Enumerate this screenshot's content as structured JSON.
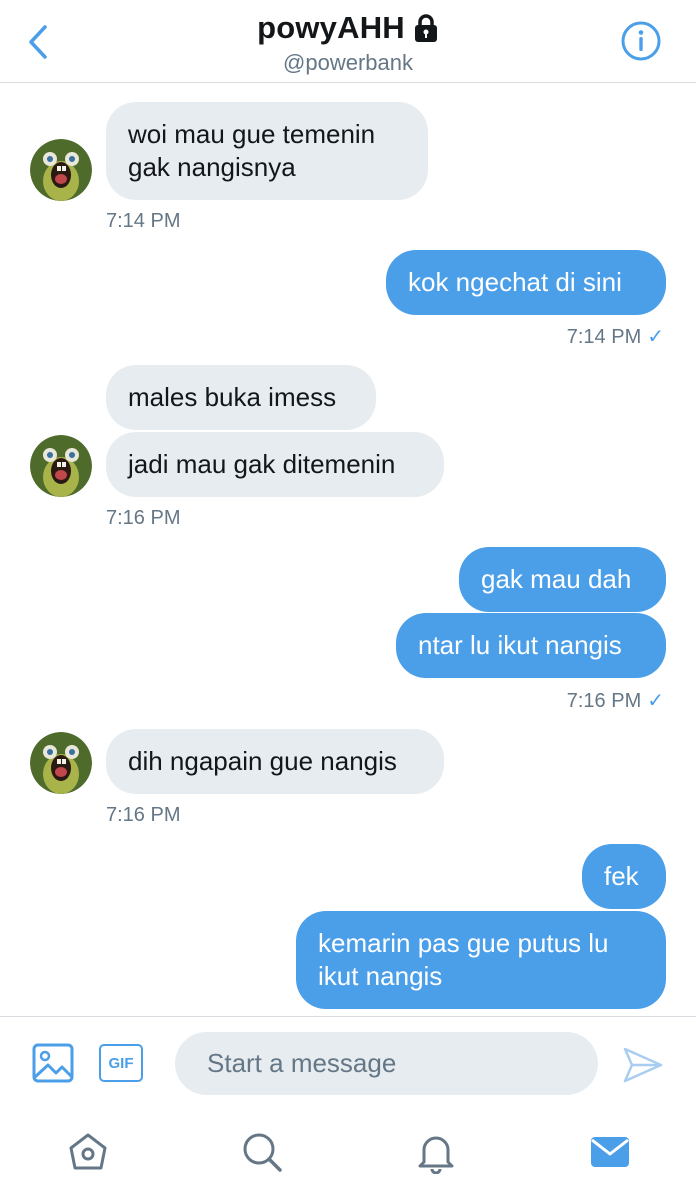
{
  "header": {
    "title": "powyAHH",
    "handle": "@powerbank",
    "back_icon": "chevron-left-icon",
    "lock_icon": "lock-icon",
    "info_icon": "info-icon"
  },
  "colors": {
    "accent": "#4b9ee8",
    "incoming_bubble": "#e6ecf0",
    "secondary_text": "#657786"
  },
  "messages": [
    {
      "direction": "in",
      "text_lines": [
        "woi mau gue temenin",
        "gak nangisnya"
      ]
    },
    {
      "direction": "in",
      "time": "7:14 PM"
    },
    {
      "direction": "out",
      "text": "kok ngechat di sini",
      "time": "7:14 PM",
      "check": "✓"
    },
    {
      "direction": "in",
      "text": "males buka imess"
    },
    {
      "direction": "in",
      "text": "jadi mau gak ditemenin",
      "time": "7:16 PM"
    },
    {
      "direction": "out",
      "text": "gak mau dah"
    },
    {
      "direction": "out",
      "text": "ntar lu ikut nangis",
      "time": "7:16 PM",
      "check": "✓"
    },
    {
      "direction": "in",
      "text": "dih ngapain gue nangis",
      "time": "7:16 PM"
    },
    {
      "direction": "out",
      "text": "fek"
    },
    {
      "direction": "out",
      "text_lines": [
        "kemarin pas gue putus lu",
        "ikut nangis"
      ]
    }
  ],
  "composer": {
    "placeholder": "Start a message",
    "gif_label": "GIF",
    "media_icon": "image-icon",
    "send_icon": "send-icon"
  },
  "tabbar": {
    "items": [
      "home-icon",
      "search-icon",
      "notifications-icon",
      "messages-icon"
    ]
  }
}
